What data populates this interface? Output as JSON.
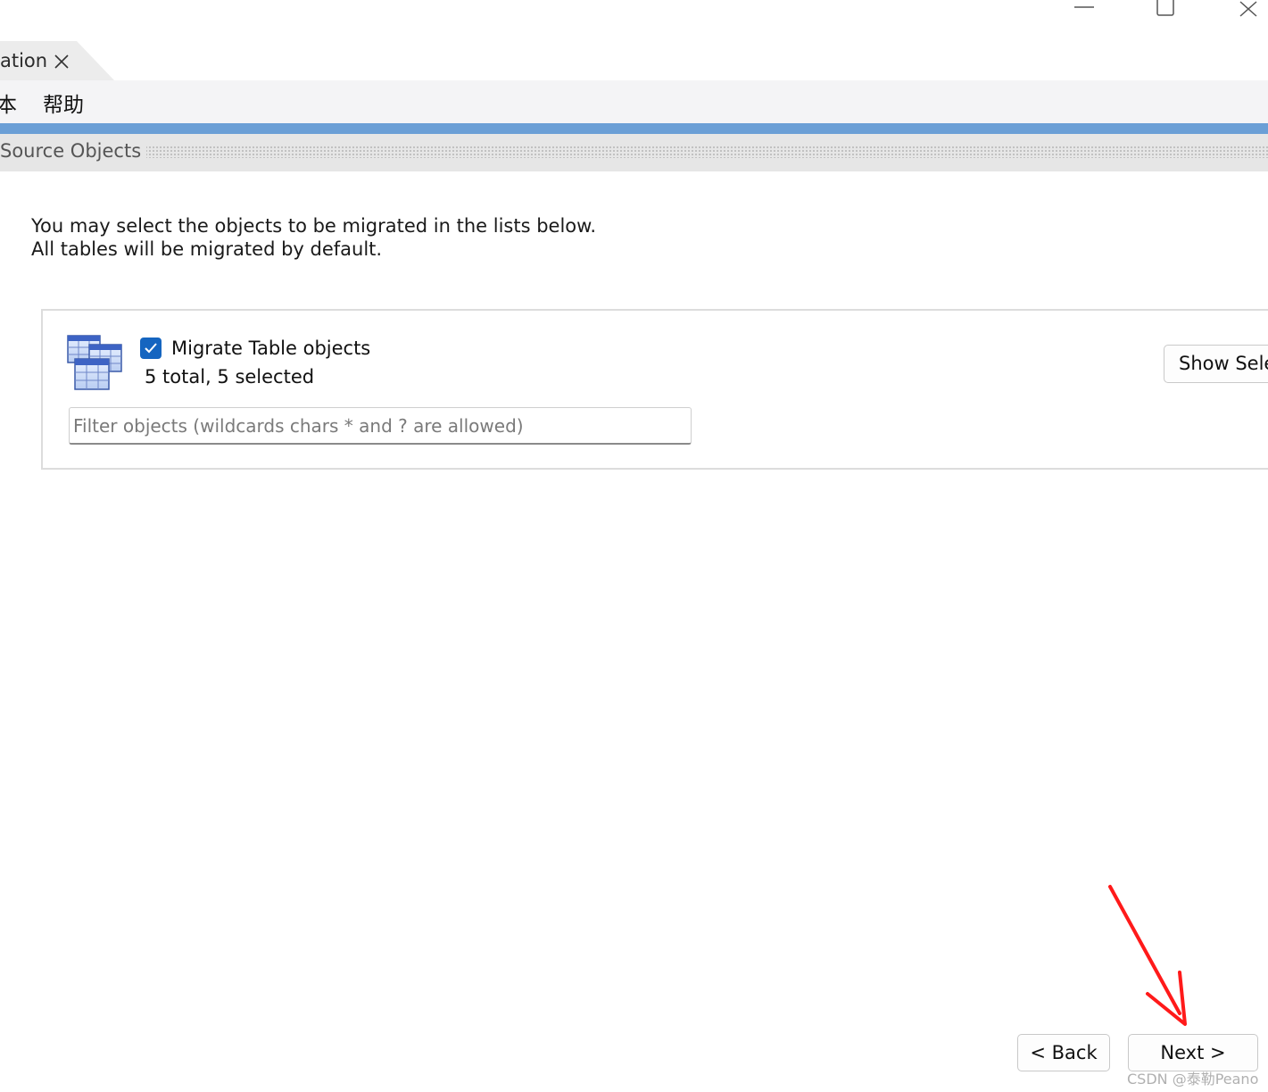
{
  "window": {
    "tab_label": "ation",
    "controls": [
      "minimize-icon",
      "maximize-icon",
      "close-icon"
    ]
  },
  "menu": {
    "items": [
      "本",
      "帮助"
    ]
  },
  "section": {
    "title": "Source Objects"
  },
  "description": {
    "line1": "You may select the objects to be migrated in the lists below.",
    "line2": "All tables will be migrated by default."
  },
  "table_objects": {
    "icon": "table-objects-icon",
    "checkbox_checked": true,
    "label": "Migrate Table objects",
    "count": "5 total, 5 selected",
    "filter_placeholder": "Filter objects (wildcards chars * and ? are allowed)",
    "filter_value": "",
    "show_button_label": "Show Selection"
  },
  "buttons": {
    "back": "< Back",
    "next": "Next >"
  },
  "annotation": {
    "arrow_color": "#ff1a1a"
  },
  "watermark": "CSDN @泰勒Peano",
  "colors": {
    "accent_stripe": "#6b9fd6",
    "checkbox": "#1565c0"
  }
}
